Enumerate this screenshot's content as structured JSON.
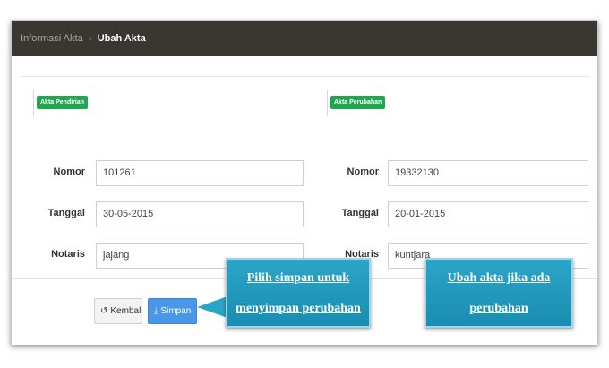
{
  "breadcrumb": {
    "parent": "Informasi Akta",
    "separator": "›",
    "current": "Ubah Akta"
  },
  "left_section": {
    "badge": "Akta Pendirian",
    "fields": [
      {
        "label": "Nomor",
        "value": "101261"
      },
      {
        "label": "Tanggal",
        "value": "30-05-2015"
      },
      {
        "label": "Notaris",
        "value": "jajang"
      }
    ]
  },
  "right_section": {
    "badge": "Akta Perubahan",
    "fields": [
      {
        "label": "Nomor",
        "value": "19332130"
      },
      {
        "label": "Tanggal",
        "value": "20-01-2015"
      },
      {
        "label": "Notaris",
        "value": "kuntjara"
      }
    ]
  },
  "buttons": {
    "back_label": "Kembali",
    "back_icon": "undo-icon",
    "save_label": "Simpan",
    "save_icon": "download-icon"
  },
  "callouts": {
    "save_hint_line1": "Pilih simpan untuk",
    "save_hint_line2": "menyimpan perubahan",
    "edit_hint_line1": "Ubah akta jika ada",
    "edit_hint_line2": "perubahan"
  },
  "colors": {
    "topbar": "#3a3733",
    "badge": "#1fa651",
    "primary_button": "#4a96e8",
    "callout": "#2aa5c8"
  }
}
